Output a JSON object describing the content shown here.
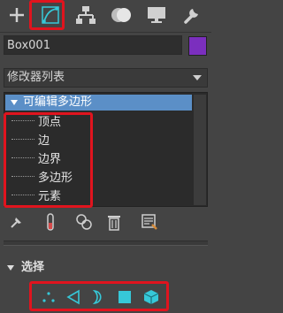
{
  "colors": {
    "panel_bg": "#444444",
    "field_bg": "#2e2e2e",
    "stack_bg": "#2b2b2b",
    "stack_highlight": "#5b8fc7",
    "object_color": "#7b2fbe",
    "highlight_red": "#e0141e",
    "accent_cyan": "#36c8d8"
  },
  "command_tabs": [
    {
      "icon": "plus-icon"
    },
    {
      "icon": "modify-icon",
      "active": true
    },
    {
      "icon": "hierarchy-icon"
    },
    {
      "icon": "motion-icon"
    },
    {
      "icon": "display-icon"
    },
    {
      "icon": "wrench-icon"
    }
  ],
  "object": {
    "name": "Box001",
    "color": "#7b2fbe"
  },
  "modifier_list": {
    "selected": "修改器列表"
  },
  "modifier_stack": {
    "title": "可编辑多边形",
    "subobjects": [
      "顶点",
      "边",
      "边界",
      "多边形",
      "元素"
    ]
  },
  "stack_tools": [
    {
      "icon": "pin-stack-icon"
    },
    {
      "icon": "show-end-result-icon"
    },
    {
      "icon": "make-unique-icon"
    },
    {
      "icon": "remove-modifier-icon"
    },
    {
      "icon": "configure-modifier-sets-icon"
    }
  ],
  "selection_rollout": {
    "title": "选择",
    "levels": [
      {
        "icon": "vertex-icon"
      },
      {
        "icon": "edge-icon"
      },
      {
        "icon": "border-icon"
      },
      {
        "icon": "polygon-icon"
      },
      {
        "icon": "element-icon"
      }
    ]
  }
}
